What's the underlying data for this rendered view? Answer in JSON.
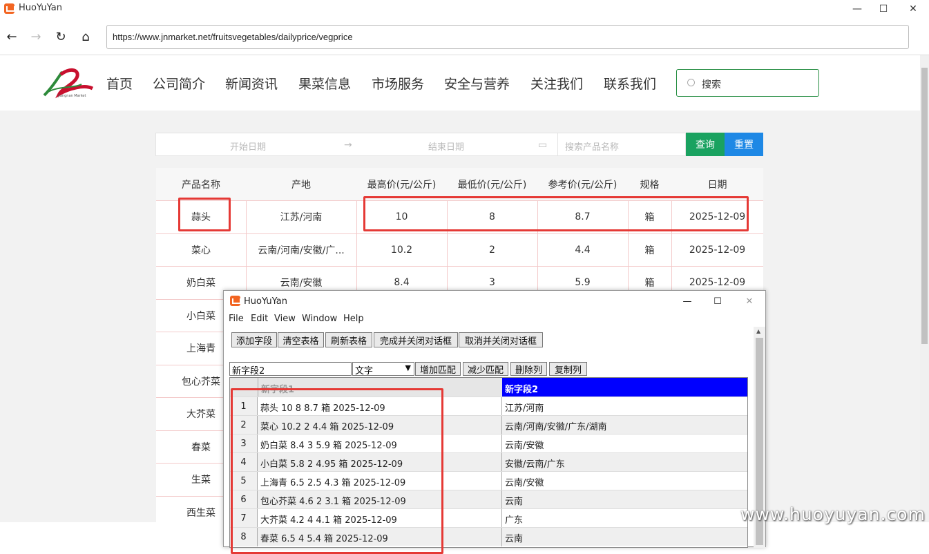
{
  "app": {
    "title": "HuoYuYan"
  },
  "browser": {
    "url": "https://www.jnmarket.net/fruitsvegetables/dailyprice/vegprice"
  },
  "site": {
    "nav": [
      "首页",
      "公司简介",
      "新闻资讯",
      "果菜信息",
      "市场服务",
      "安全与营养",
      "关注我们",
      "联系我们"
    ],
    "search_placeholder": "搜索",
    "logo_text": "Jiangnan Market"
  },
  "filter": {
    "start_placeholder": "开始日期",
    "end_placeholder": "结束日期",
    "product_placeholder": "搜索产品名称",
    "query_label": "查询",
    "reset_label": "重置"
  },
  "price_table": {
    "headers": [
      "产品名称",
      "产地",
      "最高价(元/公斤)",
      "最低价(元/公斤)",
      "参考价(元/公斤)",
      "规格",
      "日期"
    ],
    "rows": [
      [
        "蒜头",
        "江苏/河南",
        "10",
        "8",
        "8.7",
        "箱",
        "2025-12-09"
      ],
      [
        "菜心",
        "云南/河南/安徽/广...",
        "10.2",
        "2",
        "4.4",
        "箱",
        "2025-12-09"
      ],
      [
        "奶白菜",
        "云南/安徽",
        "8.4",
        "3",
        "5.9",
        "箱",
        "2025-12-09"
      ],
      [
        "小白菜",
        "",
        "",
        "",
        "",
        "",
        ""
      ],
      [
        "上海青",
        "",
        "",
        "",
        "",
        "",
        ""
      ],
      [
        "包心芥菜",
        "",
        "",
        "",
        "",
        "",
        ""
      ],
      [
        "大芥菜",
        "",
        "",
        "",
        "",
        "",
        ""
      ],
      [
        "春菜",
        "",
        "",
        "",
        "",
        "",
        ""
      ],
      [
        "生菜",
        "",
        "",
        "",
        "",
        "",
        ""
      ],
      [
        "西生菜",
        "",
        "",
        "",
        "",
        "",
        ""
      ]
    ]
  },
  "dialog": {
    "title": "HuoYuYan",
    "menu": [
      "File",
      "Edit",
      "View",
      "Window",
      "Help"
    ],
    "toolbar": [
      "添加字段",
      "清空表格",
      "刷新表格",
      "完成并关闭对话框",
      "取消并关闭对话框"
    ],
    "field_name": "新字段2",
    "field_type": "文字",
    "field_buttons": [
      "增加匹配",
      "减少匹配",
      "删除列",
      "复制列"
    ],
    "columns": [
      "新字段1",
      "新字段2"
    ],
    "rows": [
      [
        "1",
        "蒜头 10 8 8.7 箱 2025-12-09",
        "江苏/河南"
      ],
      [
        "2",
        "菜心 10.2 2 4.4 箱 2025-12-09",
        "云南/河南/安徽/广东/湖南"
      ],
      [
        "3",
        "奶白菜 8.4 3 5.9 箱 2025-12-09",
        "云南/安徽"
      ],
      [
        "4",
        "小白菜 5.8 2 4.95 箱 2025-12-09",
        "安徽/云南/广东"
      ],
      [
        "5",
        "上海青 6.5 2.5 4.3 箱 2025-12-09",
        "云南/安徽"
      ],
      [
        "6",
        "包心芥菜 4.6 2 3.1 箱 2025-12-09",
        "云南"
      ],
      [
        "7",
        "大芥菜 4.2 4 4.1 箱 2025-12-09",
        "广东"
      ],
      [
        "8",
        "春菜 6.5 4 5.4 箱 2025-12-09",
        "云南"
      ]
    ]
  },
  "watermark": "www.huoyuyan.com",
  "colors": {
    "accent_red": "#e53935",
    "query_green": "#1aa260",
    "reset_blue": "#1e88e5",
    "selected_col": "#0000ff"
  }
}
